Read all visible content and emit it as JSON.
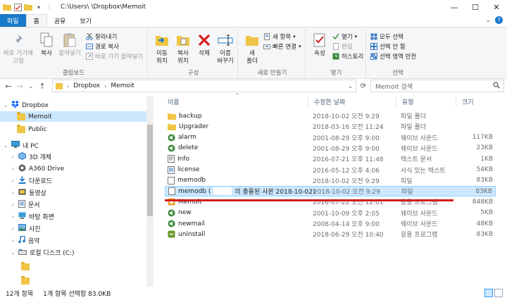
{
  "titlebar": {
    "title": "C:\\Users\\        \\Dropbox\\Memoit"
  },
  "tabs": [
    {
      "label": "파일"
    },
    {
      "label": "홈"
    },
    {
      "label": "공유"
    },
    {
      "label": "보기"
    }
  ],
  "ribbon": {
    "clipboard": {
      "label": "클립보드",
      "pin_quick": "바로 가기에\n고정",
      "copy": "복사",
      "paste": "붙여넣기",
      "cut": "잘라내기",
      "copy_path": "경로 복사",
      "paste_shortcut": "바로 가기 붙여넣기"
    },
    "organize": {
      "label": "구성",
      "move_to": "이동\n위치",
      "copy_to": "복사\n위치",
      "delete": "삭제",
      "rename": "이름\n바꾸기"
    },
    "new": {
      "label": "새로 만들기",
      "new_folder": "새\n폴더",
      "new_item": "새 항목",
      "easy_access": "빠른 연결"
    },
    "open": {
      "label": "열기",
      "properties": "속성",
      "open": "열기",
      "edit": "편집",
      "history": "히스토리"
    },
    "select": {
      "label": "선택",
      "select_all": "모두 선택",
      "select_none": "선택 안 함",
      "invert": "선택 영역 반전"
    }
  },
  "address": {
    "crumbs": [
      "Dropbox",
      "Memoit"
    ],
    "search_placeholder": "Memoit 검색"
  },
  "nav": {
    "items": [
      {
        "label": "Dropbox"
      },
      {
        "label": "Memoit"
      },
      {
        "label": "Public"
      },
      {
        "label": "내 PC"
      },
      {
        "label": "3D 개체"
      },
      {
        "label": "A360 Drive"
      },
      {
        "label": "다운로드"
      },
      {
        "label": "동영상"
      },
      {
        "label": "문서"
      },
      {
        "label": "바탕 화면"
      },
      {
        "label": "사진"
      },
      {
        "label": "음악"
      },
      {
        "label": "로컬 디스크 (C:)"
      }
    ]
  },
  "columns": {
    "name": "이름",
    "date": "수정한 날짜",
    "type": "유형",
    "size": "크기"
  },
  "files": [
    {
      "name": "backup",
      "date": "2018-10-02 오전 9:29",
      "type": "파일 폴더",
      "size": "",
      "icon": "folder"
    },
    {
      "name": "Upgrader",
      "date": "2018-03-16 오전 11:24",
      "type": "파일 폴더",
      "size": "",
      "icon": "folder"
    },
    {
      "name": "alarm",
      "date": "2001-08-29 오후 9:00",
      "type": "웨이브 사운드",
      "size": "117KB",
      "icon": "sound"
    },
    {
      "name": "delete",
      "date": "2001-08-29 오후 9:00",
      "type": "웨이브 사운드",
      "size": "23KB",
      "icon": "sound"
    },
    {
      "name": "Info",
      "date": "2016-07-21 오후 11:48",
      "type": "텍스트 문서",
      "size": "1KB",
      "icon": "text"
    },
    {
      "name": "license",
      "date": "2016-05-12 오후 4:06",
      "type": "서식 있는 텍스트",
      "size": "54KB",
      "icon": "rtf"
    },
    {
      "name": "memodb",
      "date": "2018-10-02 오전 9:29",
      "type": "파일",
      "size": "83KB",
      "icon": "file"
    },
    {
      "name": "memodb (",
      "name_tail": "의 충돌된 사본 2018-10-02)",
      "date": "2018-10-02 오전 9:29",
      "type": "파일",
      "size": "83KB",
      "icon": "file"
    },
    {
      "name": "Memoit",
      "date": "2016-07-22 오전 12:01",
      "type": "응용 프로그램",
      "size": "848KB",
      "icon": "app"
    },
    {
      "name": "new",
      "date": "2001-10-09 오후 2:05",
      "type": "웨이브 사운드",
      "size": "5KB",
      "icon": "sound"
    },
    {
      "name": "newmail",
      "date": "2008-04-14 오후 9:00",
      "type": "웨이브 사운드",
      "size": "48KB",
      "icon": "sound"
    },
    {
      "name": "uninstall",
      "date": "2018-06-29 오전 10:40",
      "type": "응용 프로그램",
      "size": "83KB",
      "icon": "uninstall"
    }
  ],
  "status": {
    "count": "12개 항목",
    "selected": "1개 항목 선택함 83.0KB"
  },
  "colors": {
    "file_tab": "#1979ca",
    "selection": "#cce8ff",
    "redline": "#d41c1c",
    "folder": "#f0c545"
  }
}
